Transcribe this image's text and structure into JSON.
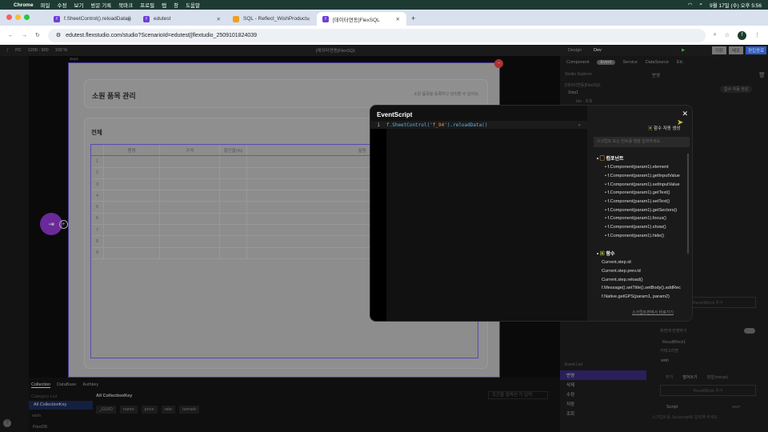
{
  "menubar": {
    "app": "Chrome",
    "items": [
      "파일",
      "수정",
      "보기",
      "방문 기록",
      "북마크",
      "프로필",
      "탭",
      "창",
      "도움말"
    ],
    "clock": "9월 17일 (수) 오후 5:56"
  },
  "tabs": [
    {
      "title": "f.SheetControl().reloadData()"
    },
    {
      "title": "edutest"
    },
    {
      "title": "SQL - Reflect_WishProduct"
    },
    {
      "title": "[데이터연동]FlexSQL",
      "active": true
    }
  ],
  "address": {
    "url": "edutest.flexstudio.com/studio?ScenarioId=edutest||flextudio_2509101824039",
    "profile": "f"
  },
  "toolbar": {
    "device": "PC",
    "size": "1200 : 900",
    "zoom": "100 %",
    "title": "[데이터연동]FlexSQL",
    "mode_tabs": [
      "Design",
      "Dev"
    ],
    "save": "저장",
    "deploy": "배포",
    "publish": "편집종료"
  },
  "page": {
    "step_label": "step1",
    "title": "소원 품목 관리",
    "subtitle": "소원 품목을 등록하고 관리할 수 있어요.",
    "section": "전체",
    "columns": [
      "품명",
      "가격",
      "할인율(%)",
      "설명"
    ],
    "rows": [
      "1",
      "2",
      "3",
      "4",
      "5",
      "6",
      "7",
      "8",
      "9"
    ]
  },
  "right": {
    "tabs": [
      "Component",
      "Event",
      "Service",
      "DataSource",
      "Etc"
    ],
    "active_tab": "Event",
    "explorer": "Studio Explorer",
    "tree_root": "[데이터연동]FlexSQL",
    "tree_step": "Step1",
    "tree_child": "btn - 조회",
    "event_name": "반영",
    "auto_gen": "함수 자동 생성",
    "param_add": "ParamBlock 추가",
    "toggle_label": "화면에 반영하기",
    "result_block": "ResultBlock1",
    "category_label": "카테고리명",
    "wish_tag": "wish",
    "radio": [
      "추가",
      "덮어쓰기",
      "병합(merge)"
    ],
    "result_add": "ResultBlock 추가",
    "script_label": "Script",
    "skip": "SKIP",
    "script_placeholder": "스크립트를 Javascript로 입력해 주세요.",
    "event_list_title": "Event List",
    "event_list": [
      "반영",
      "삭제",
      "수정",
      "저장",
      "조회"
    ]
  },
  "bottom": {
    "tabs": [
      "Collection",
      "DataBase",
      "Authkey"
    ],
    "category_list": "Category List",
    "all_key": "All CollectionKey",
    "wish": "wish",
    "header": "All CollectionKey",
    "fields": [
      "_GUID",
      "name",
      "price",
      "rate",
      "remark"
    ],
    "search_placeholder": "조건을 컬렉션 키 입력",
    "footer": "FlexDB"
  },
  "modal": {
    "title": "EventScript",
    "line": "1",
    "code_fn": "f.SheetControl(",
    "code_arg": "'f_94'",
    "code_rest": ").reloadData()",
    "auto_gen": "함수 자동 생성",
    "search_placeholder": "스크립트 또는 컨트롤 명을 입력하세요.",
    "group1": "컴포넌트",
    "group1_items": [
      "f.Component(param1).element",
      "f.Component(param1).getInputValue",
      "f.Component(param1).setInputValue",
      "f.Component(param1).getText()",
      "f.Component(param1).setText()",
      "f.Component(param1).getSectors()",
      "f.Component(param1).focus()",
      "f.Component(param1).show()",
      "f.Component(param1).hide()"
    ],
    "group2": "함수",
    "group2_items": [
      "Current.step.id",
      "Current.step.prev.id",
      "Current.step.reload()",
      "f.Message().setTitle().setBody().addRec",
      "f.Native.getGPS(param1, param2)"
    ],
    "footer_link": "스크립트편에서 바로가기"
  },
  "colors": {
    "accent": "#6d3fd6",
    "menubar": "#1d3a33",
    "publish": "#2b5cc4"
  }
}
